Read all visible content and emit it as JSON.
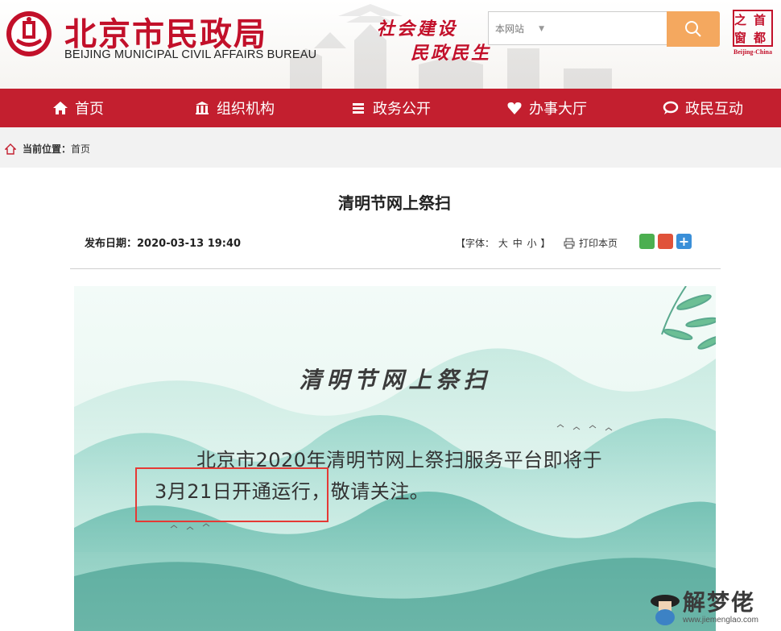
{
  "header": {
    "title_cn": "北京市民政局",
    "title_en": "BEIJING MUNICIPAL CIVIL AFFAIRS BUREAU",
    "slogan_line1": "社会建设",
    "slogan_line2": "民政民生",
    "search": {
      "scope": "本网站",
      "value": ""
    },
    "capital_window": {
      "c1": "之",
      "c2": "首",
      "c3": "窗",
      "c4": "都",
      "en": "Beijing-China"
    }
  },
  "nav": {
    "items": [
      {
        "label": "首页",
        "icon": "home-icon"
      },
      {
        "label": "组织机构",
        "icon": "building-icon"
      },
      {
        "label": "政务公开",
        "icon": "stack-icon"
      },
      {
        "label": "办事大厅",
        "icon": "heart-icon"
      },
      {
        "label": "政民互动",
        "icon": "chat-icon"
      }
    ]
  },
  "breadcrumb": {
    "label": "当前位置：",
    "current": "首页"
  },
  "article": {
    "title": "清明节网上祭扫",
    "date_label": "发布日期：",
    "date": "2020-03-13 19:40",
    "font_label_open": "【字体：",
    "font_large": "大",
    "font_medium": "中",
    "font_small": "小",
    "font_label_close": "】",
    "print_label": "打印本页"
  },
  "poster": {
    "title": "清明节网上祭扫",
    "line1": "北京市2020年清明节网上祭扫服务平台即将于",
    "line2": "3月21日开通运行，敬请关注。"
  },
  "watermark": {
    "text": "解梦佬",
    "url": "www.jiemenglao.com"
  },
  "colors": {
    "brand_red": "#c31f2f",
    "search_orange": "#f4a85f",
    "poster_bg": "#eaf8f4"
  }
}
